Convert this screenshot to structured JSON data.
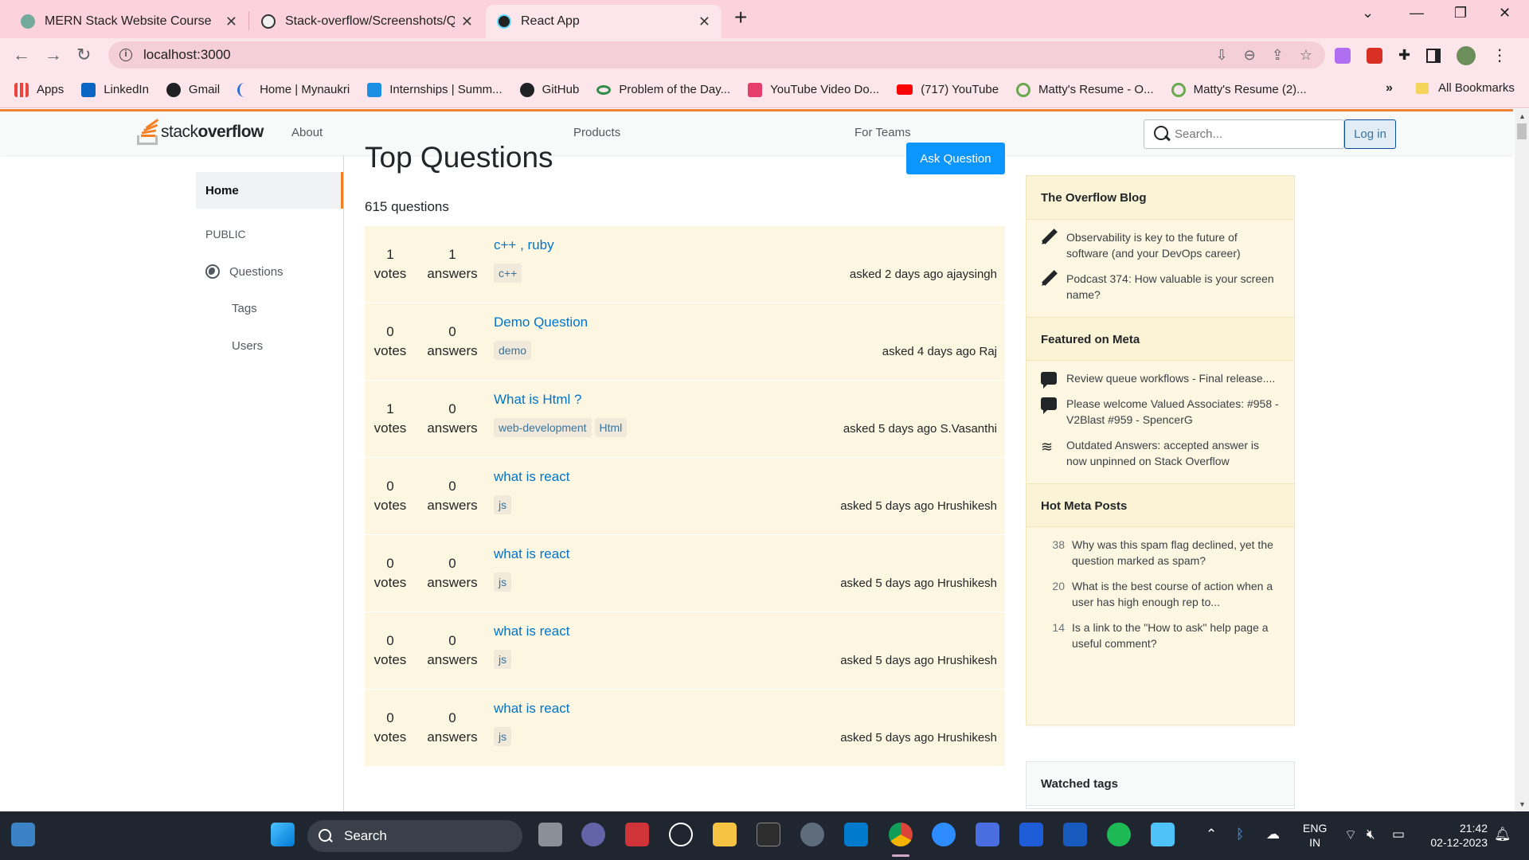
{
  "browser": {
    "tabs": [
      {
        "title": "MERN Stack Website Course",
        "active": false
      },
      {
        "title": "Stack-overflow/Screenshots/Qu",
        "active": false
      },
      {
        "title": "React App",
        "active": true
      }
    ],
    "url": "localhost:3000",
    "bookmarks": [
      {
        "label": "Apps",
        "icon": "apps-grid-icon",
        "color": "#e8453c"
      },
      {
        "label": "LinkedIn",
        "icon": "linkedin-icon",
        "color": "#0a66c2"
      },
      {
        "label": "Gmail",
        "icon": "gmail-icon",
        "color": "#202124"
      },
      {
        "label": "Home | Mynaukri",
        "icon": "mynaukri-icon",
        "color": "#2b6fd6"
      },
      {
        "label": "Internships | Summ...",
        "icon": "internshala-icon",
        "color": "#1a8fe3"
      },
      {
        "label": "GitHub",
        "icon": "github-icon",
        "color": "#202124"
      },
      {
        "label": "Problem of the Day...",
        "icon": "gfg-icon",
        "color": "#2f8d46"
      },
      {
        "label": "YouTube Video Do...",
        "icon": "download-icon",
        "color": "#e53e6d"
      },
      {
        "label": "(717) YouTube",
        "icon": "youtube-icon",
        "color": "#ff0000"
      },
      {
        "label": "Matty's Resume - O...",
        "icon": "resume-icon",
        "color": "#6aa84f"
      },
      {
        "label": "Matty's Resume (2)...",
        "icon": "resume-icon",
        "color": "#6aa84f"
      }
    ],
    "more_bookmarks": "»",
    "all_bookmarks": "All Bookmarks"
  },
  "nav": {
    "logo_light": "stack",
    "logo_bold": "overflow",
    "about": "About",
    "products": "Products",
    "for_teams": "For Teams",
    "search_placeholder": "Search...",
    "login": "Log in"
  },
  "sidebar": {
    "home": "Home",
    "public": "PUBLIC",
    "questions": "Questions",
    "tags": "Tags",
    "users": "Users"
  },
  "main": {
    "title": "Top Questions",
    "ask_button": "Ask Question",
    "count": "615 questions",
    "questions": [
      {
        "votes": "1",
        "answers": "1",
        "title": "c++ , ruby",
        "tags": [
          "c++"
        ],
        "asked": "asked 2 days ago ajaysingh"
      },
      {
        "votes": "0",
        "answers": "0",
        "title": "Demo Question",
        "tags": [
          "demo"
        ],
        "asked": "asked 4 days ago Raj"
      },
      {
        "votes": "1",
        "answers": "0",
        "title": "What is Html ?",
        "tags": [
          "web-development",
          "Html"
        ],
        "asked": "asked 5 days ago S.Vasanthi"
      },
      {
        "votes": "0",
        "answers": "0",
        "title": "what is react",
        "tags": [
          "js"
        ],
        "asked": "asked 5 days ago Hrushikesh"
      },
      {
        "votes": "0",
        "answers": "0",
        "title": "what is react",
        "tags": [
          "js"
        ],
        "asked": "asked 5 days ago Hrushikesh"
      },
      {
        "votes": "0",
        "answers": "0",
        "title": "what is react",
        "tags": [
          "js"
        ],
        "asked": "asked 5 days ago Hrushikesh"
      },
      {
        "votes": "0",
        "answers": "0",
        "title": "what is react",
        "tags": [
          "js"
        ],
        "asked": "asked 5 days ago Hrushikesh"
      }
    ],
    "votes_label": "votes",
    "answers_label": "answers"
  },
  "right": {
    "blog_title": "The Overflow Blog",
    "blog_items": [
      "Observability is key to the future of software (and your DevOps career)",
      "Podcast 374: How valuable is your screen name?"
    ],
    "meta_title": "Featured on Meta",
    "meta_items": [
      {
        "icon": "speech-bubble-icon",
        "text": "Review queue workflows - Final release...."
      },
      {
        "icon": "speech-bubble-icon",
        "text": "Please welcome Valued Associates: #958 - V2Blast #959 - SpencerG"
      },
      {
        "icon": "stack-overflow-icon",
        "text": "Outdated Answers: accepted answer is now unpinned on Stack Overflow"
      }
    ],
    "hot_title": "Hot Meta Posts",
    "hot_items": [
      {
        "num": "38",
        "text": "Why was this spam flag declined, yet the question marked as spam?"
      },
      {
        "num": "20",
        "text": "What is the best course of action when a user has high enough rep to..."
      },
      {
        "num": "14",
        "text": "Is a link to the \"How to ask\" help page a useful comment?"
      }
    ],
    "watched_title": "Watched tags"
  },
  "taskbar": {
    "search": "Search",
    "lang_top": "ENG",
    "lang_bottom": "IN",
    "time": "21:42",
    "date": "02-12-2023"
  },
  "colors": {
    "accent_orange": "#f48024",
    "link_blue": "#0074cc",
    "ask_button": "#0a95ff",
    "question_row_bg": "#fdf7e2",
    "chrome_pink": "#fcd3dd"
  }
}
